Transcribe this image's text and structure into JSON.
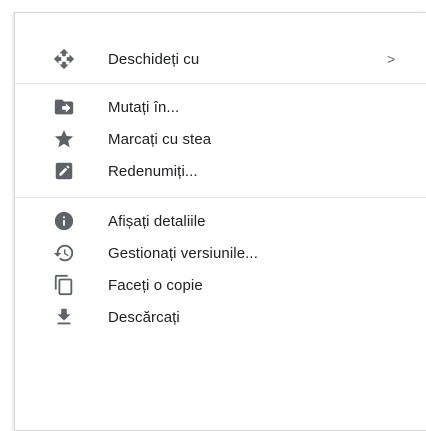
{
  "menu": {
    "items": [
      {
        "label": "Deschideți cu",
        "icon": "open-with-icon",
        "submenu_indicator": ">"
      },
      {
        "label": "Mutați în...",
        "icon": "move-to-folder-icon"
      },
      {
        "label": "Marcați cu stea",
        "icon": "star-icon"
      },
      {
        "label": "Redenumiți...",
        "icon": "rename-icon"
      },
      {
        "label": "Afișați detaliile",
        "icon": "info-icon"
      },
      {
        "label": "Gestionați versiunile...",
        "icon": "history-icon"
      },
      {
        "label": "Faceți o copie",
        "icon": "copy-icon"
      },
      {
        "label": "Descărcați",
        "icon": "download-icon"
      }
    ]
  },
  "colors": {
    "icon": "#5f6368",
    "text": "#202124",
    "divider": "#e3e3e3"
  }
}
